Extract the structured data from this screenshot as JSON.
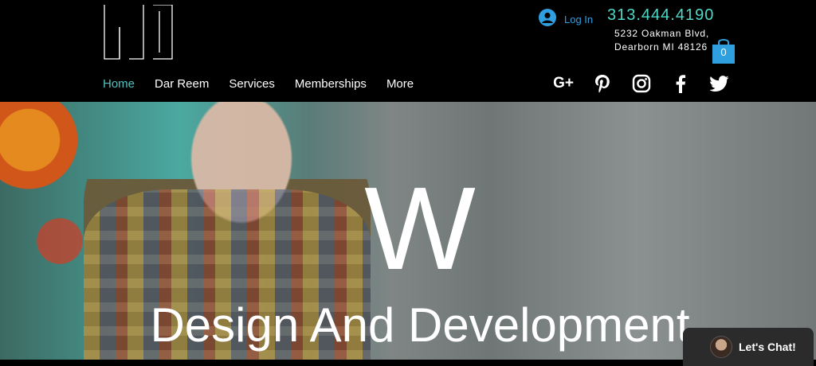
{
  "header": {
    "login_label": "Log In",
    "phone": "313.444.4190",
    "address_line1": "5232 Oakman Blvd,",
    "address_line2": "Dearborn MI 48126",
    "cart_count": "0"
  },
  "nav": {
    "items": [
      {
        "label": "Home",
        "active": true
      },
      {
        "label": "Dar Reem",
        "active": false
      },
      {
        "label": "Services",
        "active": false
      },
      {
        "label": "Memberships",
        "active": false
      },
      {
        "label": "More",
        "active": false
      }
    ]
  },
  "social": {
    "icons": [
      "google-plus-icon",
      "pinterest-icon",
      "instagram-icon",
      "facebook-icon",
      "twitter-icon"
    ],
    "google_plus_text": "G+"
  },
  "hero": {
    "title": "W",
    "tagline": "Design And Development"
  },
  "chat": {
    "label": "Let's Chat!"
  },
  "colors": {
    "accent_teal": "#4fd8c7",
    "login_blue": "#2f9fe0",
    "cart_blue": "#2f9fe0"
  }
}
